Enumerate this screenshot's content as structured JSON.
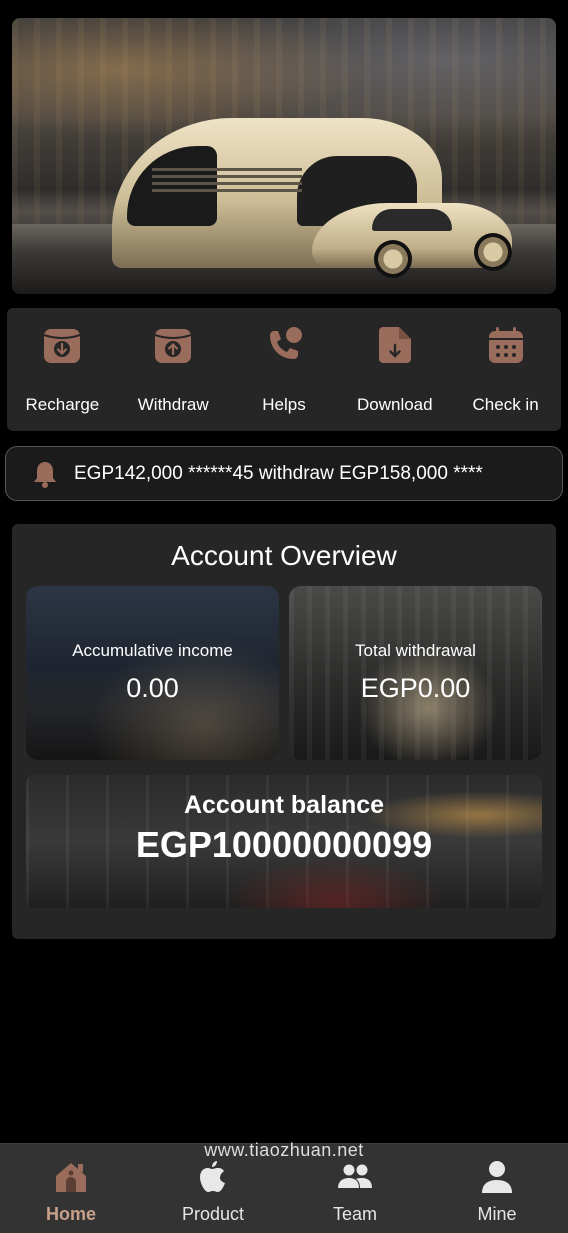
{
  "accent_color": "#9a6c5c",
  "actions": [
    {
      "label": "Recharge",
      "icon": "download-box-icon"
    },
    {
      "label": "Withdraw",
      "icon": "upload-box-icon"
    },
    {
      "label": "Helps",
      "icon": "phone-chat-icon"
    },
    {
      "label": "Download",
      "icon": "file-download-icon"
    },
    {
      "label": "Check in",
      "icon": "calendar-icon"
    }
  ],
  "notice": {
    "text": "EGP142,000  ******45 withdraw EGP158,000  ****"
  },
  "overview": {
    "title": "Account Overview",
    "accumulative_income": {
      "label": "Accumulative income",
      "value": "0.00"
    },
    "total_withdrawal": {
      "label": "Total withdrawal",
      "value": "EGP0.00"
    },
    "balance": {
      "label": "Account balance",
      "value": "EGP10000000099"
    }
  },
  "watermark": "www.tiaozhuan.net",
  "tabs": [
    {
      "label": "Home",
      "active": true
    },
    {
      "label": "Product",
      "active": false
    },
    {
      "label": "Team",
      "active": false
    },
    {
      "label": "Mine",
      "active": false
    }
  ]
}
